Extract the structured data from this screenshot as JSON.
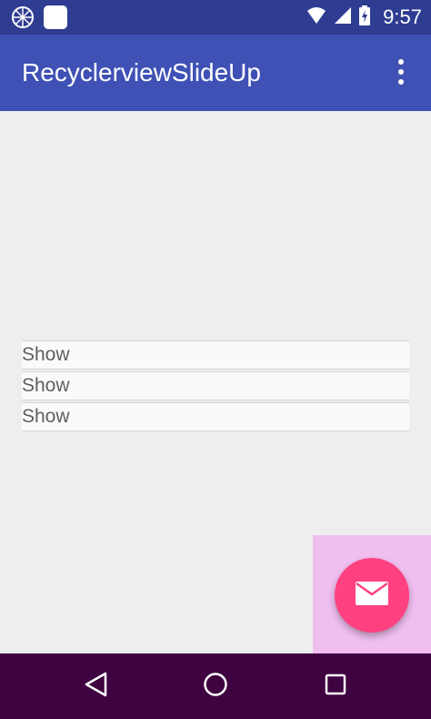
{
  "status_bar": {
    "time": "9:57",
    "icons": [
      "notification-icon",
      "app-notification-icon",
      "wifi-icon",
      "signal-icon",
      "battery-charging-icon"
    ]
  },
  "app_bar": {
    "title": "RecyclerviewSlideUp",
    "overflow_icon": "more-vert-icon"
  },
  "list": {
    "items": [
      {
        "label": "Show"
      },
      {
        "label": "Show"
      },
      {
        "label": "Show"
      }
    ]
  },
  "fab": {
    "icon": "email-icon",
    "color": "#ff4081"
  },
  "nav_bar": {
    "buttons": [
      "back-icon",
      "home-icon",
      "recents-icon"
    ]
  },
  "colors": {
    "primary": "#3f51b5",
    "primary_dark": "#2e3c92",
    "accent": "#ff4081",
    "background": "#eeeeee"
  }
}
